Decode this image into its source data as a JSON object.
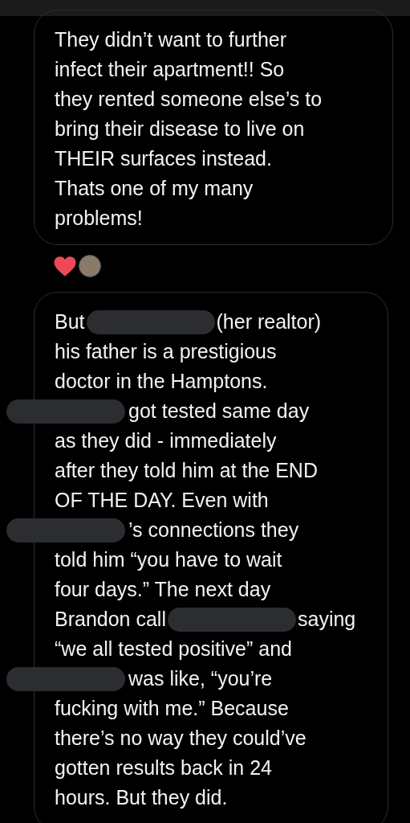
{
  "messages": [
    {
      "lines": [
        [
          {
            "kind": "text",
            "text": "They didn’t want to further"
          }
        ],
        [
          {
            "kind": "text",
            "text": "infect their apartment!! So"
          }
        ],
        [
          {
            "kind": "text",
            "text": "they rented someone else’s to"
          }
        ],
        [
          {
            "kind": "text",
            "text": "bring their disease to live on"
          }
        ],
        [
          {
            "kind": "text",
            "text": "THEIR surfaces instead."
          }
        ],
        [
          {
            "kind": "text",
            "text": "Thats one of my many"
          }
        ],
        [
          {
            "kind": "text",
            "text": "problems!"
          }
        ]
      ],
      "reactions": [
        {
          "kind": "heart"
        },
        {
          "kind": "avatar"
        }
      ]
    },
    {
      "lines": [
        [
          {
            "kind": "text",
            "text": "But"
          },
          {
            "kind": "redaction"
          },
          {
            "kind": "text",
            "text": "(her realtor)"
          }
        ],
        [
          {
            "kind": "text",
            "text": "his father is a prestigious"
          }
        ],
        [
          {
            "kind": "text",
            "text": "doctor in the Hamptons."
          }
        ],
        [
          {
            "kind": "redaction"
          },
          {
            "kind": "text",
            "text": "got tested same day"
          }
        ],
        [
          {
            "kind": "text",
            "text": "as they did - immediately"
          }
        ],
        [
          {
            "kind": "text",
            "text": "after they told him at the END"
          }
        ],
        [
          {
            "kind": "text",
            "text": "OF THE DAY. Even with"
          }
        ],
        [
          {
            "kind": "redaction"
          },
          {
            "kind": "text",
            "text": "’s connections they"
          }
        ],
        [
          {
            "kind": "text",
            "text": "told him “you have to wait"
          }
        ],
        [
          {
            "kind": "text",
            "text": "four days.” The next day"
          }
        ],
        [
          {
            "kind": "text",
            "text": "Brandon call"
          },
          {
            "kind": "redaction"
          },
          {
            "kind": "text",
            "text": "saying"
          }
        ],
        [
          {
            "kind": "text",
            "text": "“we all tested positive” and"
          }
        ],
        [
          {
            "kind": "redaction"
          },
          {
            "kind": "text",
            "text": "was like, “you’re"
          }
        ],
        [
          {
            "kind": "text",
            "text": "fucking with me.” Because"
          }
        ],
        [
          {
            "kind": "text",
            "text": "there’s no way they could’ve"
          }
        ],
        [
          {
            "kind": "text",
            "text": "gotten results back in 24"
          }
        ],
        [
          {
            "kind": "text",
            "text": "hours. But they did."
          }
        ]
      ]
    }
  ]
}
